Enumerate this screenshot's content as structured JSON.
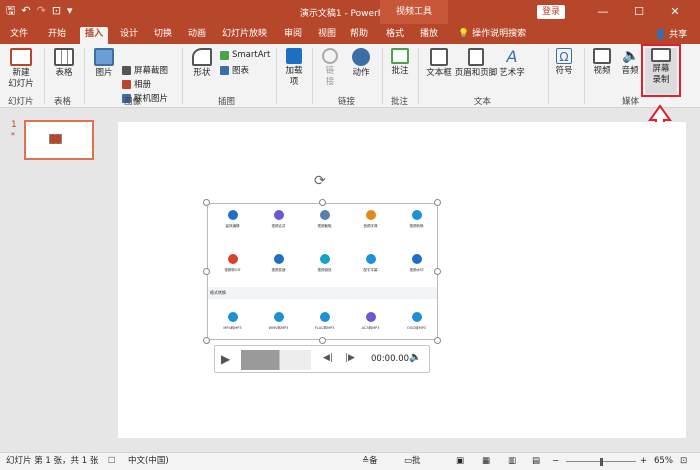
{
  "title": "演示文稿1 - PowerPoint",
  "context_tab": "视频工具",
  "login": "登录",
  "share": "共享",
  "qat": {
    "save": "🖫",
    "undo": "↶",
    "redo": "↷",
    "present": "⊡",
    "more": "▾"
  },
  "window": {
    "min": "—",
    "restore": "☐",
    "close": "✕"
  },
  "tabs": [
    "文件",
    "开始",
    "插入",
    "设计",
    "切换",
    "动画",
    "幻灯片放映",
    "审阅",
    "视图",
    "帮助",
    "格式",
    "播放",
    "操作说明搜索"
  ],
  "ribbon": {
    "new_slide": "新建\n幻灯片",
    "table": "表格",
    "pictures": "图片",
    "online_pictures": "联机图片",
    "screenshot": "屏幕截图",
    "album": "相册",
    "shapes": "形状",
    "smartart": "SmartArt",
    "chart": "图表",
    "addins": "加载\n项",
    "link": "链\n接",
    "action": "动作",
    "comment": "批注",
    "textbox": "文本框",
    "header_footer": "页眉和页脚",
    "wordart": "艺术字",
    "symbol": "符号",
    "video": "视频",
    "audio": "音频",
    "screen_recording": "屏幕\n录制"
  },
  "groups": [
    "幻灯片",
    "表格",
    "图像",
    "插图",
    "链接",
    "批注",
    "文本",
    "媒体"
  ],
  "slide": {
    "number": "1",
    "star": "*"
  },
  "video_grid": {
    "row1": [
      "高效编辑",
      "视频合并",
      "视频截取",
      "音频字典",
      "视频转换"
    ],
    "row2": [
      "视频转GIF",
      "视频变速",
      "视频倒放",
      "配字字幕",
      "视频水印"
    ],
    "section_label": "格式转换",
    "row3": [
      "MP4转MP3",
      "WMV转MP3",
      "FLAC转MP3",
      "AC3转MP3",
      "OGG转MP3"
    ]
  },
  "player": {
    "time": "00:00.00"
  },
  "status": {
    "slide_info": "幻灯片 第 1 张，共 1 张",
    "language": "中文(中国)",
    "notes": "备注",
    "comments": "批注",
    "zoom": "65%"
  },
  "colors": {
    "accent": "#b7472a",
    "highlight": "#e0202a"
  }
}
